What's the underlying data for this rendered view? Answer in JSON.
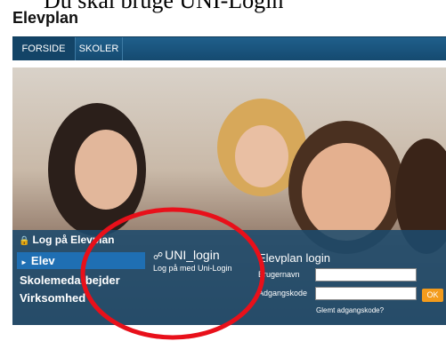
{
  "caption": "Du skal bruge UNI-Login",
  "app": {
    "title": "Elevplan"
  },
  "nav": {
    "items": [
      "FORSIDE",
      "SKOLER"
    ]
  },
  "login": {
    "panel_title": "Log på Elevplan",
    "roles": [
      "Elev",
      "Skolemedarbejder",
      "Virksomhed"
    ],
    "active_role": "Elev",
    "uni_title": "UNI_login",
    "uni_subtitle": "Log på med Uni-Login",
    "elevplan_title": "Elevplan login",
    "username_label": "Brugernavn",
    "password_label": "Adgangskode",
    "ok_label": "OK",
    "forgot_label": "Glemt adgangskode?"
  },
  "colors": {
    "nav_bg": "#1a5681",
    "panel_bg": "#1c4a6c",
    "active_role": "#1f6fb3",
    "ok_button": "#f39b1c",
    "annotation": "#e8101a"
  },
  "icons": [
    "lock-icon",
    "arrow-right-icon",
    "link-icon"
  ]
}
